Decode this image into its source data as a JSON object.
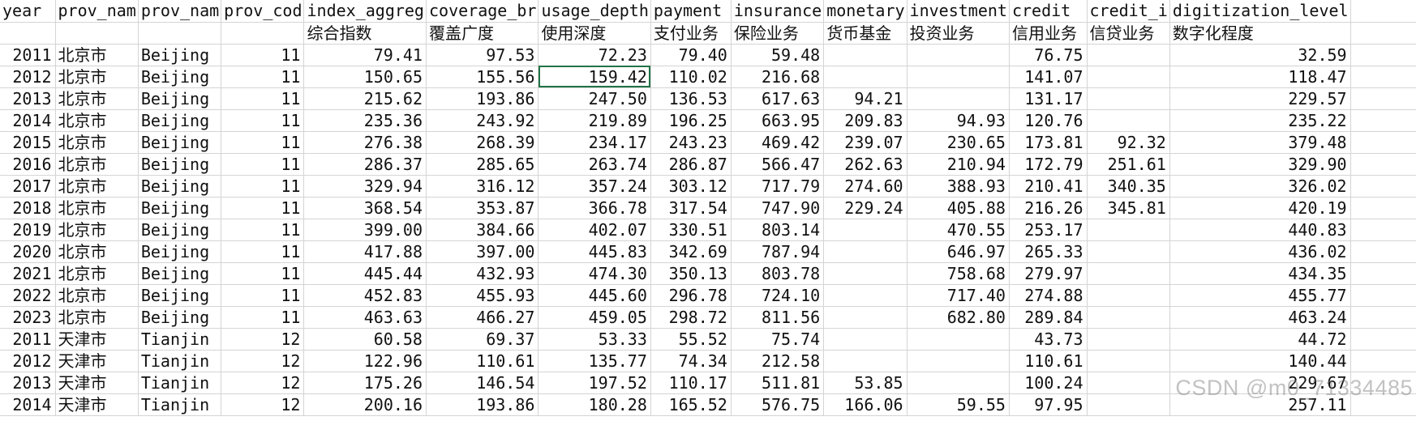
{
  "selected_cell": {
    "row": 1,
    "col": 6
  },
  "columns": [
    {
      "header": "year",
      "header2": "",
      "align": "num"
    },
    {
      "header": "prov_nam",
      "header2": "",
      "align": "txt"
    },
    {
      "header": "prov_nam",
      "header2": "",
      "align": "txt"
    },
    {
      "header": "prov_cod",
      "header2": "",
      "align": "num"
    },
    {
      "header": "index_aggreg",
      "header2": "综合指数",
      "align": "num"
    },
    {
      "header": "coverage_br",
      "header2": "覆盖广度",
      "align": "num"
    },
    {
      "header": "usage_depth",
      "header2": "使用深度",
      "align": "num"
    },
    {
      "header": "payment",
      "header2": "支付业务",
      "align": "num"
    },
    {
      "header": "insurance",
      "header2": "保险业务",
      "align": "num"
    },
    {
      "header": "monetary",
      "header2": "货币基金",
      "align": "num"
    },
    {
      "header": "investment",
      "header2": "投资业务",
      "align": "num"
    },
    {
      "header": "credit",
      "header2": "信用业务",
      "align": "num"
    },
    {
      "header": "credit_i",
      "header2": "信贷业务",
      "align": "num"
    },
    {
      "header": "digitization_level",
      "header2": "数字化程度",
      "align": "num"
    },
    {
      "header": "",
      "header2": "",
      "align": "num"
    }
  ],
  "rows": [
    [
      "2011",
      "北京市",
      "Beijing",
      "11",
      "79.41",
      "97.53",
      "72.23",
      "79.40",
      "59.48",
      "",
      "",
      "76.75",
      "",
      "32.59",
      ""
    ],
    [
      "2012",
      "北京市",
      "Beijing",
      "11",
      "150.65",
      "155.56",
      "159.42",
      "110.02",
      "216.68",
      "",
      "",
      "141.07",
      "",
      "118.47",
      ""
    ],
    [
      "2013",
      "北京市",
      "Beijing",
      "11",
      "215.62",
      "193.86",
      "247.50",
      "136.53",
      "617.63",
      "94.21",
      "",
      "131.17",
      "",
      "229.57",
      ""
    ],
    [
      "2014",
      "北京市",
      "Beijing",
      "11",
      "235.36",
      "243.92",
      "219.89",
      "196.25",
      "663.95",
      "209.83",
      "94.93",
      "120.76",
      "",
      "235.22",
      ""
    ],
    [
      "2015",
      "北京市",
      "Beijing",
      "11",
      "276.38",
      "268.39",
      "234.17",
      "243.23",
      "469.42",
      "239.07",
      "230.65",
      "173.81",
      "92.32",
      "379.48",
      ""
    ],
    [
      "2016",
      "北京市",
      "Beijing",
      "11",
      "286.37",
      "285.65",
      "263.74",
      "286.87",
      "566.47",
      "262.63",
      "210.94",
      "172.79",
      "251.61",
      "329.90",
      ""
    ],
    [
      "2017",
      "北京市",
      "Beijing",
      "11",
      "329.94",
      "316.12",
      "357.24",
      "303.12",
      "717.79",
      "274.60",
      "388.93",
      "210.41",
      "340.35",
      "326.02",
      ""
    ],
    [
      "2018",
      "北京市",
      "Beijing",
      "11",
      "368.54",
      "353.87",
      "366.78",
      "317.54",
      "747.90",
      "229.24",
      "405.88",
      "216.26",
      "345.81",
      "420.19",
      ""
    ],
    [
      "2019",
      "北京市",
      "Beijing",
      "11",
      "399.00",
      "384.66",
      "402.07",
      "330.51",
      "803.14",
      "",
      "470.55",
      "253.17",
      "",
      "440.83",
      ""
    ],
    [
      "2020",
      "北京市",
      "Beijing",
      "11",
      "417.88",
      "397.00",
      "445.83",
      "342.69",
      "787.94",
      "",
      "646.97",
      "265.33",
      "",
      "436.02",
      ""
    ],
    [
      "2021",
      "北京市",
      "Beijing",
      "11",
      "445.44",
      "432.93",
      "474.30",
      "350.13",
      "803.78",
      "",
      "758.68",
      "279.97",
      "",
      "434.35",
      ""
    ],
    [
      "2022",
      "北京市",
      "Beijing",
      "11",
      "452.83",
      "455.93",
      "445.60",
      "296.78",
      "724.10",
      "",
      "717.40",
      "274.88",
      "",
      "455.77",
      ""
    ],
    [
      "2023",
      "北京市",
      "Beijing",
      "11",
      "463.63",
      "466.27",
      "459.05",
      "298.72",
      "811.56",
      "",
      "682.80",
      "289.84",
      "",
      "463.24",
      ""
    ],
    [
      "2011",
      "天津市",
      "Tianjin",
      "12",
      "60.58",
      "69.37",
      "53.33",
      "55.52",
      "75.74",
      "",
      "",
      "43.73",
      "",
      "44.72",
      ""
    ],
    [
      "2012",
      "天津市",
      "Tianjin",
      "12",
      "122.96",
      "110.61",
      "135.77",
      "74.34",
      "212.58",
      "",
      "",
      "110.61",
      "",
      "140.44",
      ""
    ],
    [
      "2013",
      "天津市",
      "Tianjin",
      "12",
      "175.26",
      "146.54",
      "197.52",
      "110.17",
      "511.81",
      "53.85",
      "",
      "100.24",
      "",
      "229.67",
      ""
    ],
    [
      "2014",
      "天津市",
      "Tianjin",
      "12",
      "200.16",
      "193.86",
      "180.28",
      "165.52",
      "576.75",
      "166.06",
      "59.55",
      "97.95",
      "",
      "257.11",
      ""
    ]
  ],
  "watermark": "CSDN @m0_71334485"
}
